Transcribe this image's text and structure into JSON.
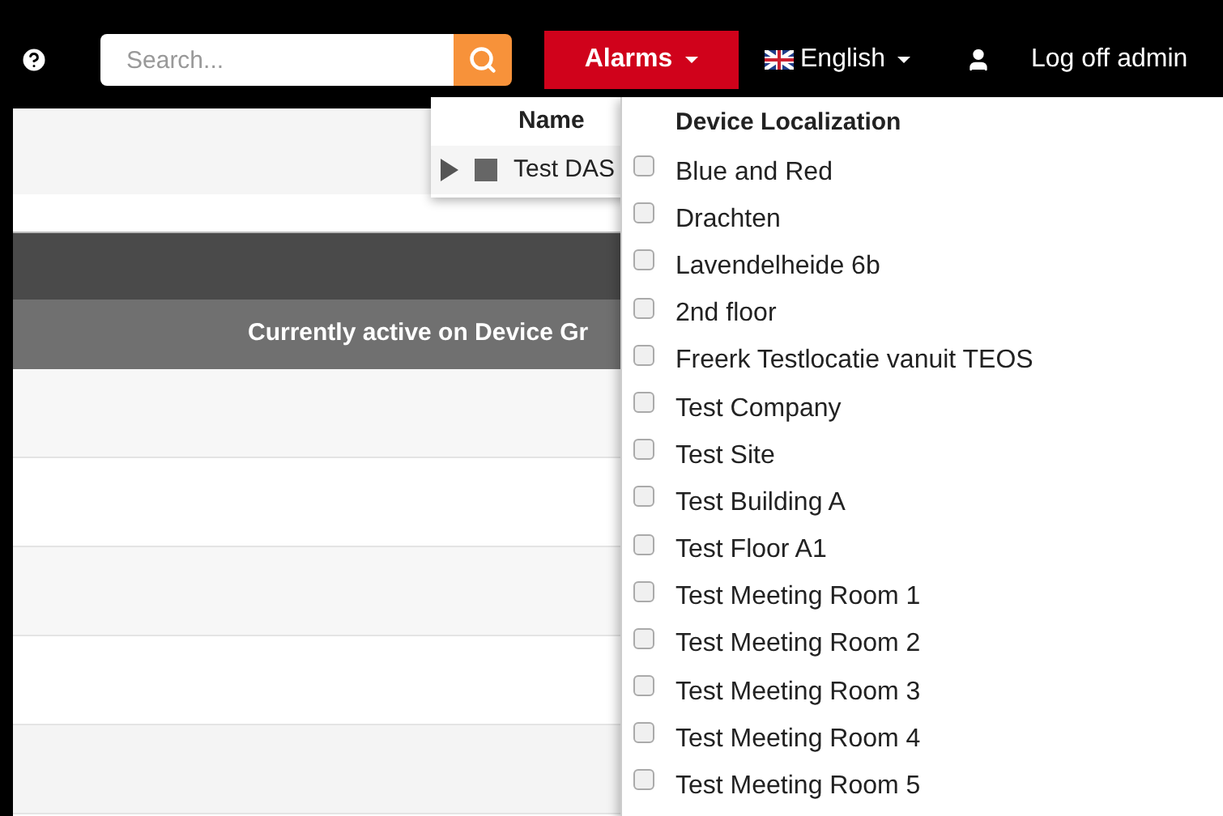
{
  "navbar": {
    "search": {
      "placeholder": "Search..."
    },
    "alarms": "Alarms",
    "language": "English",
    "logoff": "Log off admin"
  },
  "table": {
    "header": "Currently active on Device Gr"
  },
  "name_popup": {
    "header": "Name",
    "rows": [
      {
        "label": "Test DAS"
      }
    ]
  },
  "localization_menu": {
    "title": "Device Localization",
    "items": [
      {
        "label": "Blue and Red",
        "checked": false
      },
      {
        "label": "Drachten",
        "checked": false
      },
      {
        "label": "Lavendelheide 6b",
        "checked": false
      },
      {
        "label": "2nd floor",
        "checked": false
      },
      {
        "label": "Freerk Testlocatie vanuit TEOS",
        "checked": false
      },
      {
        "label": "Test Company",
        "checked": false
      },
      {
        "label": "Test Site",
        "checked": false
      },
      {
        "label": "Test Building A",
        "checked": false
      },
      {
        "label": "Test Floor A1",
        "checked": false
      },
      {
        "label": "Test Meeting Room 1",
        "checked": false
      },
      {
        "label": "Test Meeting Room 2",
        "checked": false
      },
      {
        "label": "Test Meeting Room 3",
        "checked": false
      },
      {
        "label": "Test Meeting Room 4",
        "checked": false
      },
      {
        "label": "Test Meeting Room 5",
        "checked": false
      }
    ]
  }
}
